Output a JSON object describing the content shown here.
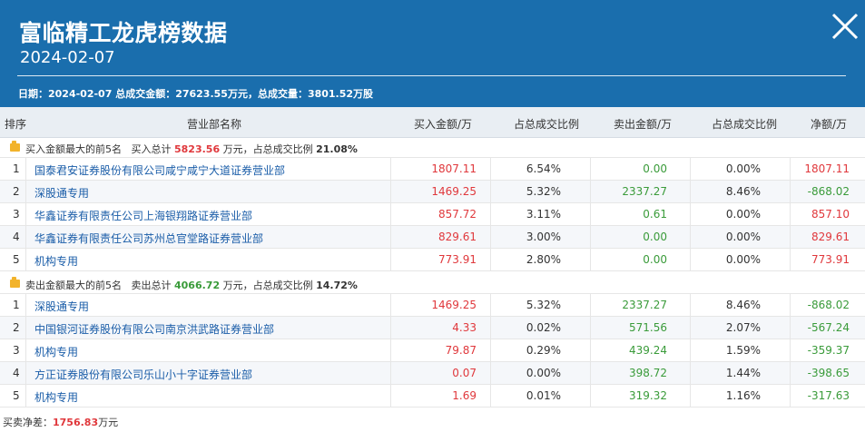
{
  "header": {
    "title": "富临精工龙虎榜数据",
    "date": "2024-02-07",
    "summary": "日期：2024-02-07 总成交金额：27623.55万元，总成交量：3801.52万股"
  },
  "columns": [
    "排序",
    "营业部名称",
    "买入金额/万",
    "占总成交比例",
    "卖出金额/万",
    "占总成交比例",
    "净额/万"
  ],
  "buy_group": {
    "label": "买入金额最大的前5名",
    "total_label": "买入总计",
    "total_value": "5823.56",
    "unit_label": "万元，占总成交比例",
    "ratio": "21.08%"
  },
  "buy_rows": [
    {
      "rank": "1",
      "name": "国泰君安证券股份有限公司咸宁咸宁大道证券营业部",
      "buy": "1807.11",
      "buy_pct": "6.54%",
      "sell": "0.00",
      "sell_pct": "0.00%",
      "net": "1807.11"
    },
    {
      "rank": "2",
      "name": "深股通专用",
      "buy": "1469.25",
      "buy_pct": "5.32%",
      "sell": "2337.27",
      "sell_pct": "8.46%",
      "net": "-868.02"
    },
    {
      "rank": "3",
      "name": "华鑫证券有限责任公司上海银翔路证券营业部",
      "buy": "857.72",
      "buy_pct": "3.11%",
      "sell": "0.61",
      "sell_pct": "0.00%",
      "net": "857.10"
    },
    {
      "rank": "4",
      "name": "华鑫证券有限责任公司苏州总官堂路证券营业部",
      "buy": "829.61",
      "buy_pct": "3.00%",
      "sell": "0.00",
      "sell_pct": "0.00%",
      "net": "829.61"
    },
    {
      "rank": "5",
      "name": "机构专用",
      "buy": "773.91",
      "buy_pct": "2.80%",
      "sell": "0.00",
      "sell_pct": "0.00%",
      "net": "773.91"
    }
  ],
  "sell_group": {
    "label": "卖出金额最大的前5名",
    "total_label": "卖出总计",
    "total_value": "4066.72",
    "unit_label": "万元，占总成交比例",
    "ratio": "14.72%"
  },
  "sell_rows": [
    {
      "rank": "1",
      "name": "深股通专用",
      "buy": "1469.25",
      "buy_pct": "5.32%",
      "sell": "2337.27",
      "sell_pct": "8.46%",
      "net": "-868.02"
    },
    {
      "rank": "2",
      "name": "中国银河证券股份有限公司南京洪武路证券营业部",
      "buy": "4.33",
      "buy_pct": "0.02%",
      "sell": "571.56",
      "sell_pct": "2.07%",
      "net": "-567.24"
    },
    {
      "rank": "3",
      "name": "机构专用",
      "buy": "79.87",
      "buy_pct": "0.29%",
      "sell": "439.24",
      "sell_pct": "1.59%",
      "net": "-359.37"
    },
    {
      "rank": "4",
      "name": "方正证券股份有限公司乐山小十字证券营业部",
      "buy": "0.07",
      "buy_pct": "0.00%",
      "sell": "398.72",
      "sell_pct": "1.44%",
      "net": "-398.65"
    },
    {
      "rank": "5",
      "name": "机构专用",
      "buy": "1.69",
      "buy_pct": "0.01%",
      "sell": "319.32",
      "sell_pct": "1.16%",
      "net": "-317.63"
    }
  ],
  "footer": {
    "label": "买卖净差：",
    "value": "1756.83",
    "unit": "万元"
  },
  "colors": {
    "header_bg": "#1a6ead",
    "up": "#e0383c",
    "down": "#3a9b3a",
    "link": "#1a5da8"
  },
  "icons": {
    "close": "close-icon",
    "group": "folder-icon"
  }
}
